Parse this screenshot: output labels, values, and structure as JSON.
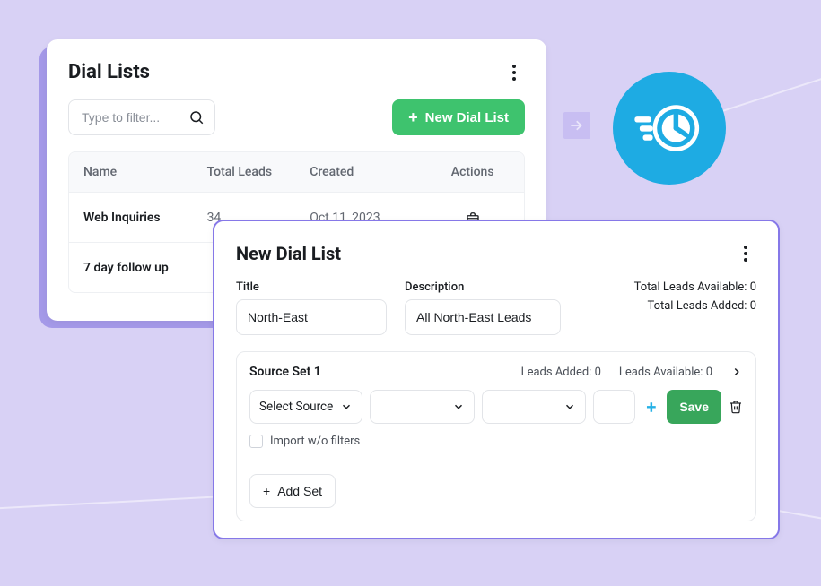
{
  "dial_lists": {
    "title": "Dial Lists",
    "filter_placeholder": "Type to filter...",
    "new_button": "New Dial List",
    "columns": {
      "name": "Name",
      "total_leads": "Total Leads",
      "created": "Created",
      "actions": "Actions"
    },
    "rows": [
      {
        "name": "Web Inquiries",
        "total_leads": "34",
        "created": "Oct 11, 2023"
      },
      {
        "name": "7 day follow up",
        "total_leads": "",
        "created": ""
      }
    ]
  },
  "new_dial": {
    "title": "New Dial List",
    "title_label": "Title",
    "title_value": "North-East",
    "description_label": "Description",
    "description_value": "All North-East Leads",
    "total_available_label": "Total Leads Available:",
    "total_available_value": "0",
    "total_added_label": "Total Leads Added:",
    "total_added_value": "0",
    "source_set": {
      "name": "Source Set 1",
      "leads_added_label": "Leads Added:",
      "leads_added_value": "0",
      "leads_available_label": "Leads Available:",
      "leads_available_value": "0",
      "select_source_label": "Select Source",
      "save_label": "Save",
      "import_label": "Import w/o filters"
    },
    "add_set_label": "Add Set"
  }
}
